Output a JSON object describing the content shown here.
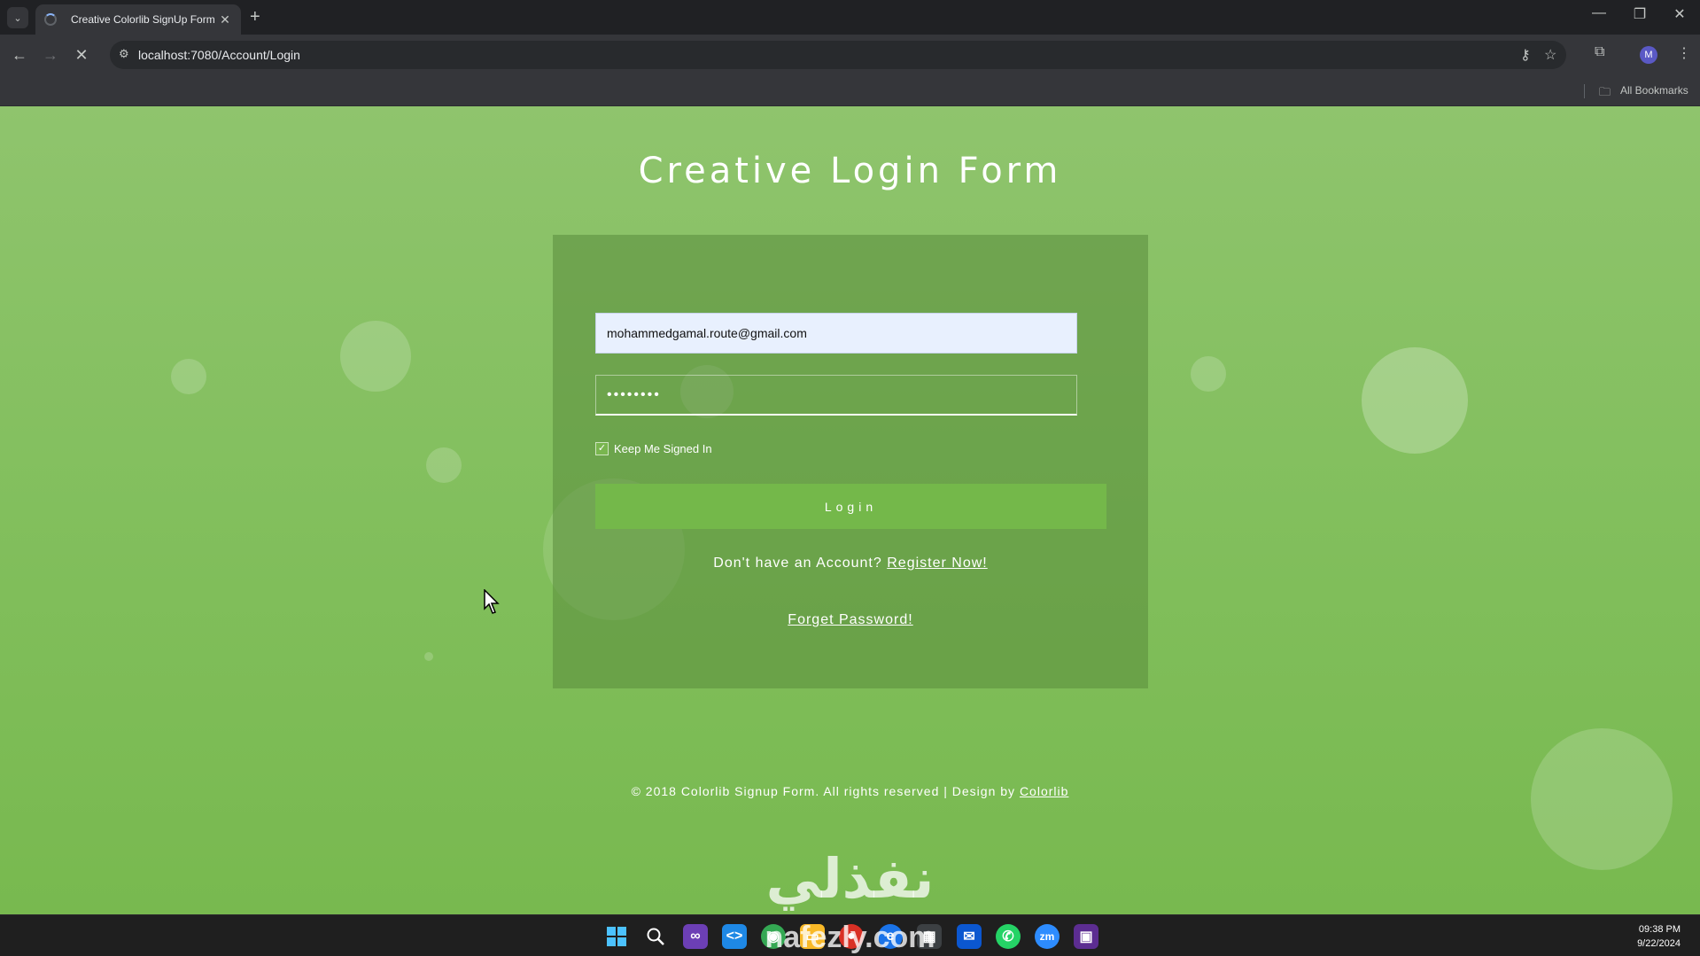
{
  "browser": {
    "tab_title": "Creative Colorlib SignUp Form",
    "tab_close": "✕",
    "new_tab": "+",
    "url": "localhost:7080/Account/Login",
    "bookmarks_label": "All Bookmarks",
    "profile_initial": "M"
  },
  "page": {
    "title": "Creative Login Form",
    "email_value": "mohammedgamal.route@gmail.com",
    "password_value": "••••••••",
    "remember_label": "Keep Me Signed In",
    "remember_checked": true,
    "login_label": "Login",
    "no_account_text": "Don't have an Account?",
    "register_link": "Register Now!",
    "forgot_link": "Forget Password!",
    "footer_text": "© 2018 Colorlib Signup Form. All rights reserved | Design by",
    "footer_link": "Colorlib"
  },
  "watermark": {
    "arabic": "نفذلي",
    "latin": "nafezly.com"
  },
  "taskbar": {
    "time": "09:38 PM",
    "date": "9/22/2024",
    "apps": [
      "windows-start-icon",
      "search-icon",
      "visual-studio-icon",
      "vscode-icon",
      "chrome-icon",
      "file-explorer-icon",
      "edge-icon",
      "calendar-icon",
      "mail-icon",
      "whatsapp-icon",
      "zoom-icon",
      "terminal-icon"
    ]
  },
  "colors": {
    "page_green": "#82bf5d",
    "button_green": "#74b84a",
    "chrome_dark": "#202124"
  }
}
